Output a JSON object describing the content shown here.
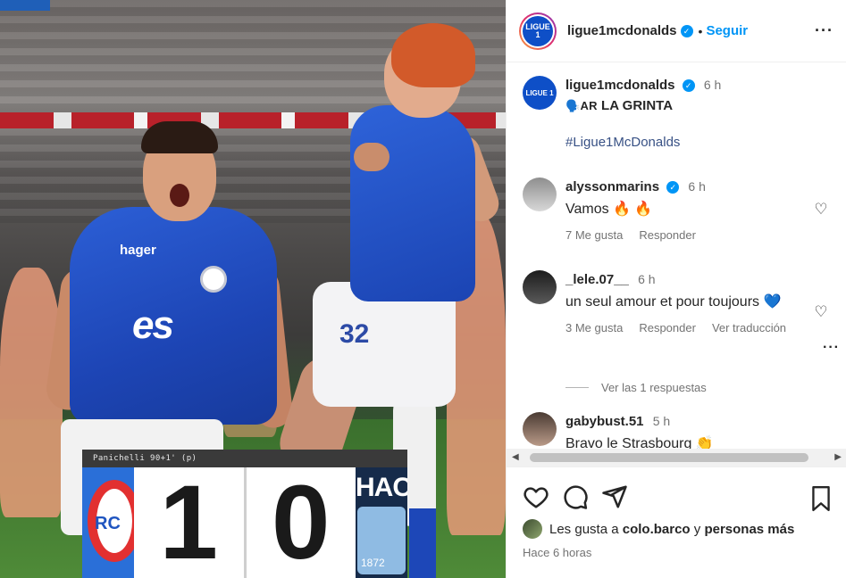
{
  "post": {
    "username": "ligue1mcdonalds",
    "follow_label": "Seguir",
    "avatar_text": "LIGUE 1",
    "caption_prefix": "🗣️AR",
    "caption_title": "LA GRINTA",
    "hashtag": "#Ligue1McDonalds",
    "caption_time": "6 h",
    "time_ago": "Hace 6 horas"
  },
  "photo": {
    "sponsor_es": "es",
    "sponsor_hager": "hager",
    "player_number": "32",
    "scoreboard": {
      "scorer_line": "Panichelli 90+1' (p)",
      "home_score": "1",
      "away_score": "0",
      "home_abbr": "RC",
      "away_abbr": "HAC",
      "away_year": "1872"
    }
  },
  "comments": [
    {
      "user": "alyssonmarins",
      "verified": true,
      "time": "6 h",
      "text": "Vamos 🔥 🔥",
      "likes": "7 Me gusta",
      "reply": "Responder"
    },
    {
      "user": "_lele.07__",
      "verified": false,
      "time": "6 h",
      "text": "un seul amour et pour toujours 💙",
      "likes": "3 Me gusta",
      "reply": "Responder",
      "translate": "Ver traducción",
      "view_replies": "Ver las 1 respuestas"
    },
    {
      "user": "gabybust.51",
      "verified": false,
      "time": "5 h",
      "text": "Bravo le Strasbourg 👏"
    }
  ],
  "likes_line": {
    "prefix": "Les gusta a",
    "user": "colo.barco",
    "mid": "y",
    "suffix": "personas más"
  },
  "icons": {
    "like": "heart-icon",
    "comment": "comment-icon",
    "share": "send-icon",
    "save": "bookmark-icon",
    "more": "more-icon"
  },
  "colors": {
    "accent": "#0095f6",
    "brand_blue": "#0e4fc7",
    "muted": "#737373"
  }
}
